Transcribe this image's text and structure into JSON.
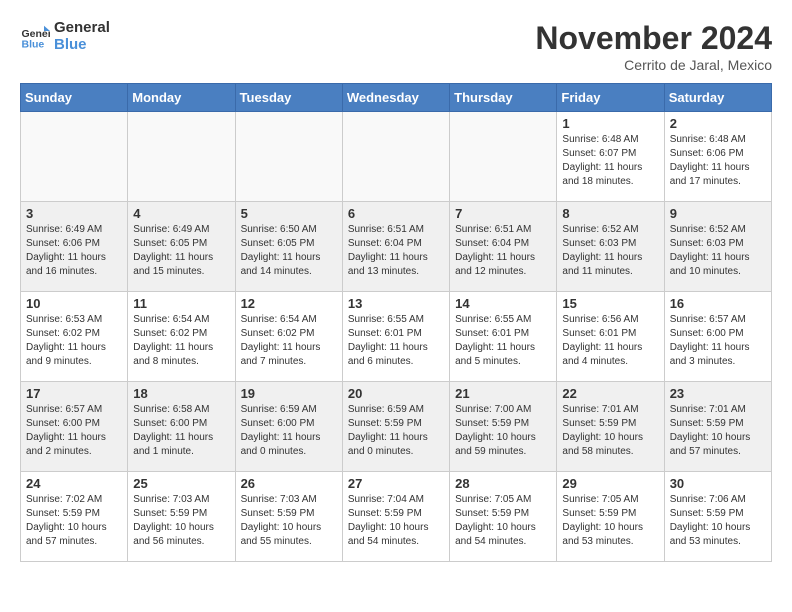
{
  "header": {
    "logo_line1": "General",
    "logo_line2": "Blue",
    "month": "November 2024",
    "location": "Cerrito de Jaral, Mexico"
  },
  "weekdays": [
    "Sunday",
    "Monday",
    "Tuesday",
    "Wednesday",
    "Thursday",
    "Friday",
    "Saturday"
  ],
  "weeks": [
    [
      {
        "day": "",
        "info": ""
      },
      {
        "day": "",
        "info": ""
      },
      {
        "day": "",
        "info": ""
      },
      {
        "day": "",
        "info": ""
      },
      {
        "day": "",
        "info": ""
      },
      {
        "day": "1",
        "info": "Sunrise: 6:48 AM\nSunset: 6:07 PM\nDaylight: 11 hours and 18 minutes."
      },
      {
        "day": "2",
        "info": "Sunrise: 6:48 AM\nSunset: 6:06 PM\nDaylight: 11 hours and 17 minutes."
      }
    ],
    [
      {
        "day": "3",
        "info": "Sunrise: 6:49 AM\nSunset: 6:06 PM\nDaylight: 11 hours and 16 minutes."
      },
      {
        "day": "4",
        "info": "Sunrise: 6:49 AM\nSunset: 6:05 PM\nDaylight: 11 hours and 15 minutes."
      },
      {
        "day": "5",
        "info": "Sunrise: 6:50 AM\nSunset: 6:05 PM\nDaylight: 11 hours and 14 minutes."
      },
      {
        "day": "6",
        "info": "Sunrise: 6:51 AM\nSunset: 6:04 PM\nDaylight: 11 hours and 13 minutes."
      },
      {
        "day": "7",
        "info": "Sunrise: 6:51 AM\nSunset: 6:04 PM\nDaylight: 11 hours and 12 minutes."
      },
      {
        "day": "8",
        "info": "Sunrise: 6:52 AM\nSunset: 6:03 PM\nDaylight: 11 hours and 11 minutes."
      },
      {
        "day": "9",
        "info": "Sunrise: 6:52 AM\nSunset: 6:03 PM\nDaylight: 11 hours and 10 minutes."
      }
    ],
    [
      {
        "day": "10",
        "info": "Sunrise: 6:53 AM\nSunset: 6:02 PM\nDaylight: 11 hours and 9 minutes."
      },
      {
        "day": "11",
        "info": "Sunrise: 6:54 AM\nSunset: 6:02 PM\nDaylight: 11 hours and 8 minutes."
      },
      {
        "day": "12",
        "info": "Sunrise: 6:54 AM\nSunset: 6:02 PM\nDaylight: 11 hours and 7 minutes."
      },
      {
        "day": "13",
        "info": "Sunrise: 6:55 AM\nSunset: 6:01 PM\nDaylight: 11 hours and 6 minutes."
      },
      {
        "day": "14",
        "info": "Sunrise: 6:55 AM\nSunset: 6:01 PM\nDaylight: 11 hours and 5 minutes."
      },
      {
        "day": "15",
        "info": "Sunrise: 6:56 AM\nSunset: 6:01 PM\nDaylight: 11 hours and 4 minutes."
      },
      {
        "day": "16",
        "info": "Sunrise: 6:57 AM\nSunset: 6:00 PM\nDaylight: 11 hours and 3 minutes."
      }
    ],
    [
      {
        "day": "17",
        "info": "Sunrise: 6:57 AM\nSunset: 6:00 PM\nDaylight: 11 hours and 2 minutes."
      },
      {
        "day": "18",
        "info": "Sunrise: 6:58 AM\nSunset: 6:00 PM\nDaylight: 11 hours and 1 minute."
      },
      {
        "day": "19",
        "info": "Sunrise: 6:59 AM\nSunset: 6:00 PM\nDaylight: 11 hours and 0 minutes."
      },
      {
        "day": "20",
        "info": "Sunrise: 6:59 AM\nSunset: 5:59 PM\nDaylight: 11 hours and 0 minutes."
      },
      {
        "day": "21",
        "info": "Sunrise: 7:00 AM\nSunset: 5:59 PM\nDaylight: 10 hours and 59 minutes."
      },
      {
        "day": "22",
        "info": "Sunrise: 7:01 AM\nSunset: 5:59 PM\nDaylight: 10 hours and 58 minutes."
      },
      {
        "day": "23",
        "info": "Sunrise: 7:01 AM\nSunset: 5:59 PM\nDaylight: 10 hours and 57 minutes."
      }
    ],
    [
      {
        "day": "24",
        "info": "Sunrise: 7:02 AM\nSunset: 5:59 PM\nDaylight: 10 hours and 57 minutes."
      },
      {
        "day": "25",
        "info": "Sunrise: 7:03 AM\nSunset: 5:59 PM\nDaylight: 10 hours and 56 minutes."
      },
      {
        "day": "26",
        "info": "Sunrise: 7:03 AM\nSunset: 5:59 PM\nDaylight: 10 hours and 55 minutes."
      },
      {
        "day": "27",
        "info": "Sunrise: 7:04 AM\nSunset: 5:59 PM\nDaylight: 10 hours and 54 minutes."
      },
      {
        "day": "28",
        "info": "Sunrise: 7:05 AM\nSunset: 5:59 PM\nDaylight: 10 hours and 54 minutes."
      },
      {
        "day": "29",
        "info": "Sunrise: 7:05 AM\nSunset: 5:59 PM\nDaylight: 10 hours and 53 minutes."
      },
      {
        "day": "30",
        "info": "Sunrise: 7:06 AM\nSunset: 5:59 PM\nDaylight: 10 hours and 53 minutes."
      }
    ]
  ]
}
